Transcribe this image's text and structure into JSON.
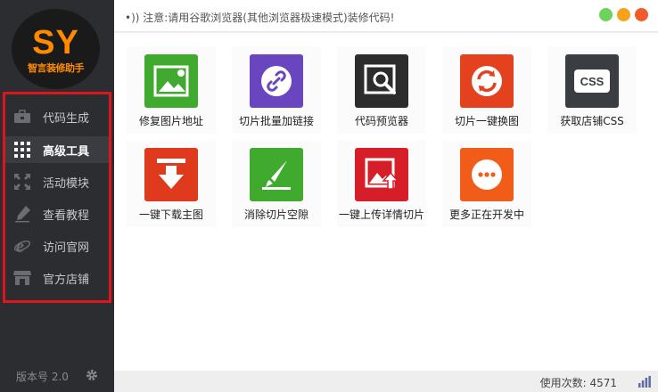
{
  "logo": {
    "text": "SY",
    "subtitle": "智言装修助手"
  },
  "sidebar": {
    "items": [
      {
        "label": "代码生成",
        "icon": "briefcase-icon"
      },
      {
        "label": "高级工具",
        "icon": "grid-icon"
      },
      {
        "label": "活动模块",
        "icon": "expand-icon"
      },
      {
        "label": "查看教程",
        "icon": "pen-icon"
      },
      {
        "label": "访问官网",
        "icon": "ie-icon"
      },
      {
        "label": "官方店铺",
        "icon": "store-icon"
      }
    ],
    "active_index": 1,
    "version": "版本号 2.0"
  },
  "topbar": {
    "notice": "•)) 注意:请用谷歌浏览器(其他浏览器极速模式)装修代码!",
    "window_buttons": [
      "#6dd35a",
      "#f7a21b",
      "#f35c2a"
    ]
  },
  "tools": [
    {
      "label": "修复图片地址",
      "icon": "image-repair-icon",
      "color": "#3faa2e"
    },
    {
      "label": "切片批量加链接",
      "icon": "link-icon",
      "color": "#6a45c0"
    },
    {
      "label": "代码预览器",
      "icon": "preview-icon",
      "color": "#2c2c2c"
    },
    {
      "label": "切片一键换图",
      "icon": "swap-image-icon",
      "color": "#e4421f"
    },
    {
      "label": "获取店铺CSS",
      "icon": "css-icon",
      "color": "#3a3d42"
    },
    {
      "label": "一键下载主图",
      "icon": "download-icon",
      "color": "#e03a1e"
    },
    {
      "label": "消除切片空隙",
      "icon": "slice-gap-icon",
      "color": "#3faa2e"
    },
    {
      "label": "一键上传详情切片",
      "icon": "upload-icon",
      "color": "#d51e27"
    },
    {
      "label": "更多正在开发中",
      "icon": "more-icon",
      "color": "#f25c19"
    }
  ],
  "statusbar": {
    "usage": "使用次数: 4571"
  }
}
